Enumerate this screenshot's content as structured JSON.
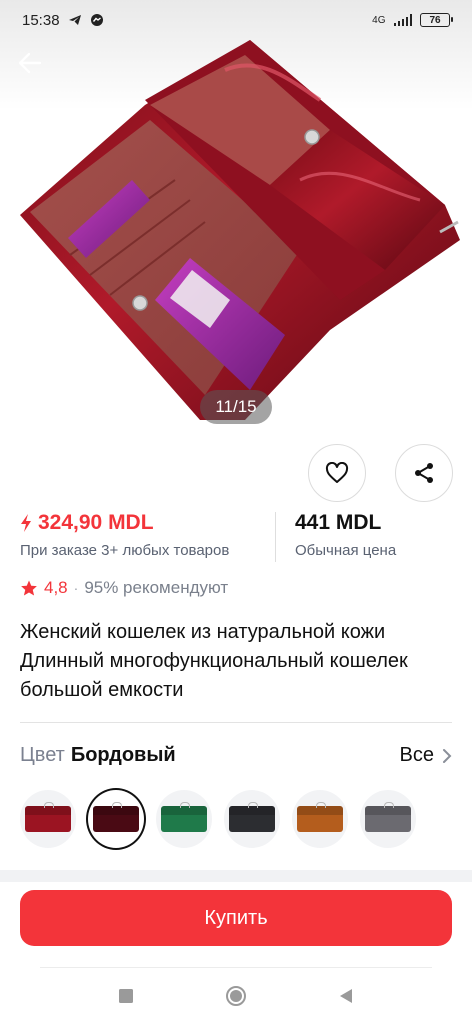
{
  "status": {
    "time": "15:38",
    "network": "4G",
    "battery": "76"
  },
  "gallery": {
    "counter": "11/15"
  },
  "price": {
    "current": "324,90 MDL",
    "current_note": "При заказе 3+ любых товаров",
    "regular": "441 MDL",
    "regular_label": "Обычная цена"
  },
  "rating": {
    "value": "4,8",
    "recommend": "95% рекомендуют"
  },
  "product": {
    "title": "Женский кошелек из натуральной кожи Длинный многофункциональный кошелек большой емкости"
  },
  "color": {
    "label": "Цвет",
    "value": "Бордовый",
    "all_label": "Все",
    "swatches": [
      {
        "name": "red",
        "color": "#9b1422"
      },
      {
        "name": "burgundy",
        "color": "#4a0a14"
      },
      {
        "name": "green",
        "color": "#1f7a4a"
      },
      {
        "name": "black",
        "color": "#2c2d31"
      },
      {
        "name": "brown",
        "color": "#b45d1d"
      },
      {
        "name": "grey",
        "color": "#6b6a70"
      }
    ]
  },
  "actions": {
    "buy_label": "Купить"
  },
  "colors": {
    "accent": "#f3343a",
    "muted": "#5a6272"
  }
}
